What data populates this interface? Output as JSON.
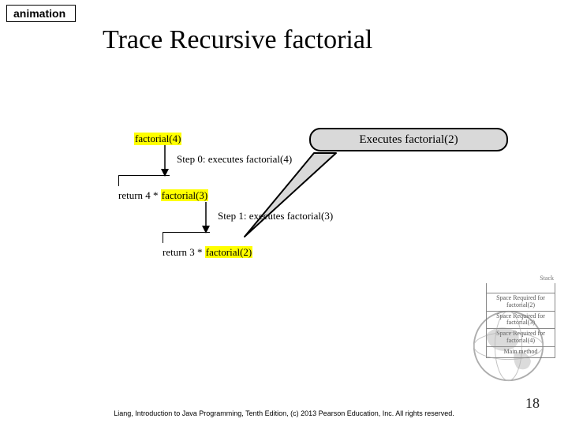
{
  "animation_label": "animation",
  "title": "Trace Recursive factorial",
  "callout": "Executes factorial(2)",
  "diagram": {
    "top_call": "factorial(4)",
    "step0": "Step 0: executes factorial(4)",
    "ret0_prefix": "return 4 * ",
    "ret0_call": "factorial(3)",
    "step1": "Step 1: executes factorial(3)",
    "ret1_prefix": "return 3 * ",
    "ret1_call": "factorial(2)"
  },
  "stack": {
    "label": "Stack",
    "rows": [
      "Space Required for factorial(2)",
      "Space Required for factorial(3)",
      "Space Required for factorial(4)",
      "Main method"
    ]
  },
  "footer": "Liang, Introduction to Java Programming, Tenth Edition, (c) 2013 Pearson Education, Inc. All rights reserved.",
  "page_number": "18"
}
